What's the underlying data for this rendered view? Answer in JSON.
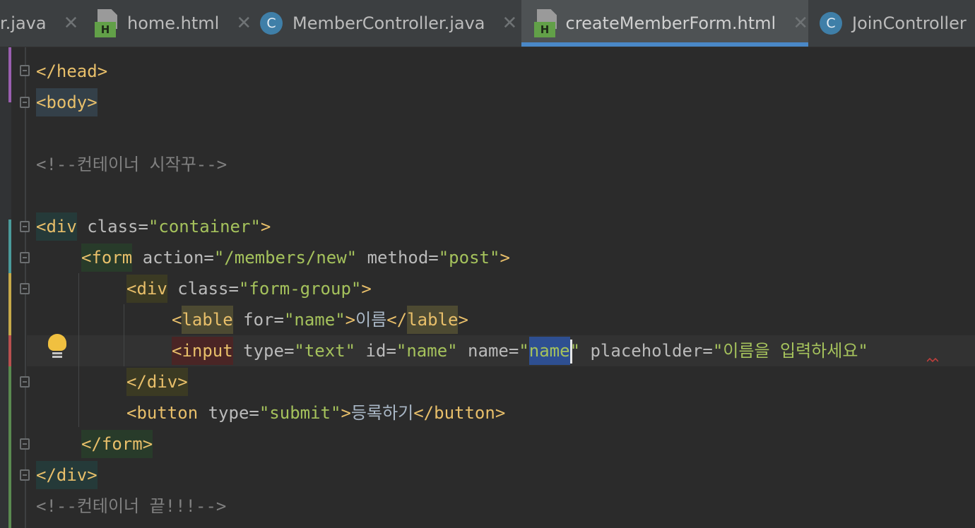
{
  "tabs": [
    {
      "label": "r.java",
      "icon": "none",
      "active": false
    },
    {
      "label": "home.html",
      "icon": "html-file-icon",
      "active": false
    },
    {
      "label": "MemberController.java",
      "icon": "java-class-icon",
      "active": false
    },
    {
      "label": "createMemberForm.html",
      "icon": "html-file-icon",
      "active": true
    },
    {
      "label": "JoinController",
      "icon": "java-class-icon",
      "active": false
    }
  ],
  "close_glyph": "✕",
  "icon_letters": {
    "class": "C",
    "html": "H"
  },
  "code": {
    "l1": {
      "tag": "</head>"
    },
    "l2": {
      "tag": "<body>"
    },
    "l3": {
      "comment": "<!--컨테이너 시작꾸-->"
    },
    "l4": {
      "open": "<div",
      "attr": " class=",
      "val": "\"container\"",
      "close": ">"
    },
    "l5": {
      "open": "<form",
      "attr1": " action=",
      "val1": "\"/members/new\"",
      "attr2": " method=",
      "val2": "\"post\"",
      "close": ">"
    },
    "l6": {
      "open": "<div",
      "attr": " class=",
      "val": "\"form-group\"",
      "close": ">"
    },
    "l7": {
      "open_lt": "<",
      "open_name": "lable",
      "attr": " for=",
      "val": "\"name\"",
      "gt": ">",
      "text": "이름",
      "close_lt": "</",
      "close_name": "lable",
      "close_gt": ">"
    },
    "l8": {
      "open": "<input",
      "attr1": " type=",
      "val1": "\"text\"",
      "attr2": " id=",
      "val2": "\"name\"",
      "attr3": " name=",
      "q1": "\"",
      "sel": "name",
      "q2": "\"",
      "attr4": " placeholder=",
      "val4": "\"이름을 입력하세요\""
    },
    "l9": {
      "tag": "</div>"
    },
    "l10": {
      "open": "<button",
      "attr": " type=",
      "val": "\"submit\"",
      "gt": ">",
      "text": "등록하기",
      "close": "</button>"
    },
    "l11": {
      "tag": "</form>"
    },
    "l12": {
      "tag": "</div>"
    },
    "l13": {
      "comment": "<!--컨테이너 끝!!!-->"
    }
  },
  "colors": {
    "tag": "#e8bf6a",
    "attribute": "#bababa",
    "string": "#a5c25c",
    "comment": "#808080",
    "background": "#2b2b2b",
    "active_tab_underline": "#4a88c7"
  }
}
